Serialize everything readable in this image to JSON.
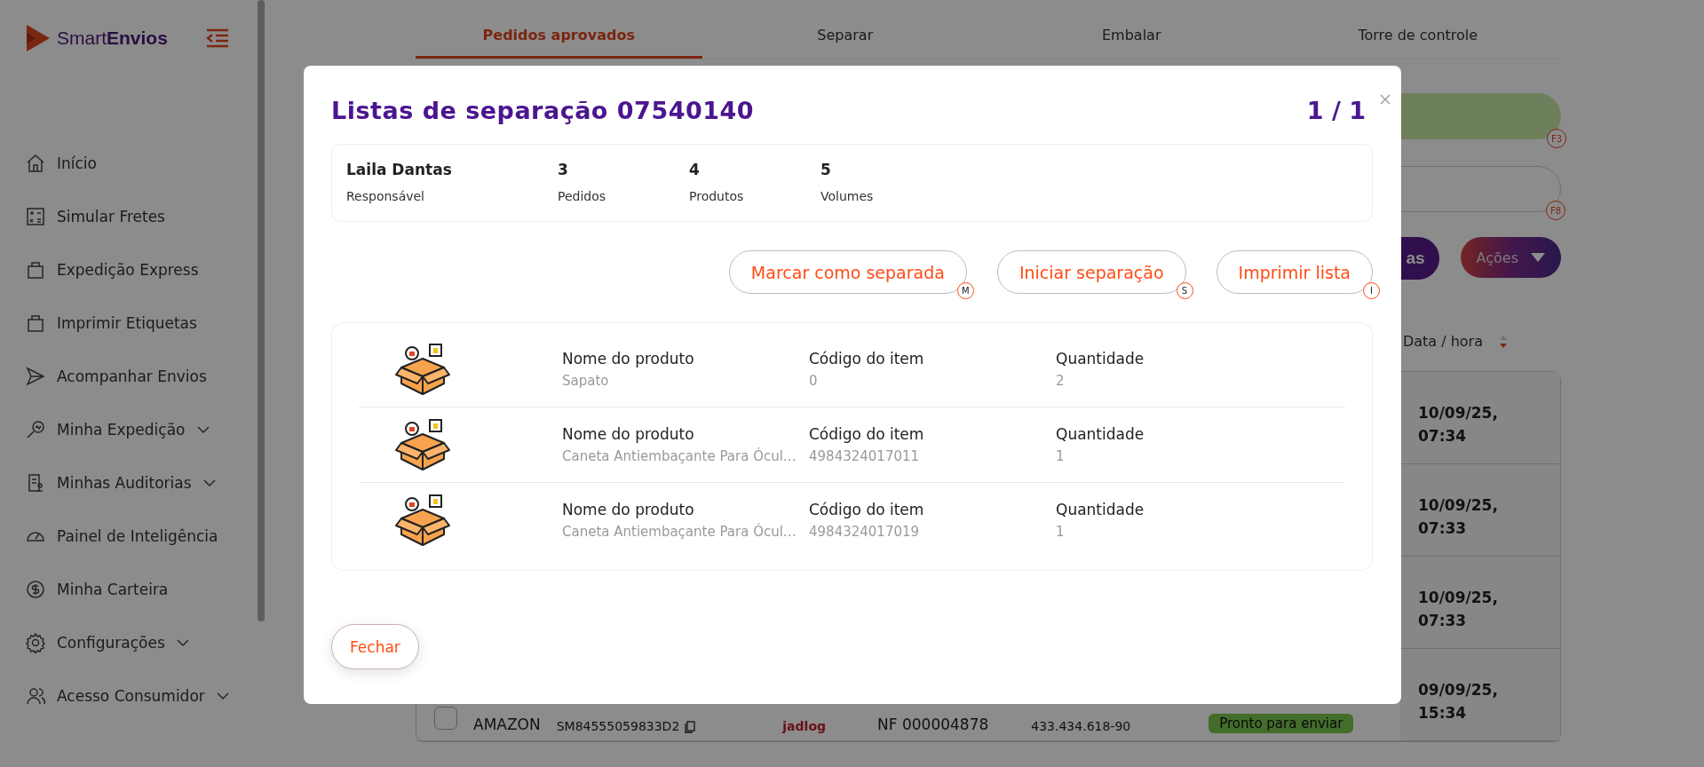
{
  "sidebar": {
    "logo": {
      "light": "Smart",
      "bold": "Envios"
    },
    "items": [
      {
        "label": "Início",
        "expandable": false
      },
      {
        "label": "Simular Fretes",
        "expandable": false
      },
      {
        "label": "Expedição Express",
        "expandable": false
      },
      {
        "label": "Imprimir Etiquetas",
        "expandable": false
      },
      {
        "label": "Acompanhar Envios",
        "expandable": false
      },
      {
        "label": "Minha Expedição",
        "expandable": true
      },
      {
        "label": "Minhas Auditorias",
        "expandable": true
      },
      {
        "label": "Painel de Inteligência",
        "expandable": false
      },
      {
        "label": "Minha Carteira",
        "expandable": false
      },
      {
        "label": "Configurações",
        "expandable": true
      },
      {
        "label": "Acesso Consumidor",
        "expandable": true
      }
    ]
  },
  "tabs": [
    {
      "label": "Pedidos aprovados",
      "selected": true
    },
    {
      "label": "Separar",
      "selected": false
    },
    {
      "label": "Embalar",
      "selected": false
    },
    {
      "label": "Torre de controle",
      "selected": false
    }
  ],
  "shortcuts": [
    "F3",
    "F8"
  ],
  "toolbar": {
    "partial_button": "as",
    "actions_button": "Ações"
  },
  "table": {
    "date_header": "Data / hora",
    "rows": [
      {
        "date": "10/09/25,",
        "time": "07:34"
      },
      {
        "date": "10/09/25,",
        "time": "07:33"
      },
      {
        "date": "10/09/25,",
        "time": "07:33"
      },
      {
        "date": "09/09/25,",
        "time": "15:34",
        "checked": false,
        "store": "AMAZON",
        "tracking": "SM84555059833D2",
        "carrier": "jadlog",
        "invoice": "NF 000004878",
        "document": "433.434.618-90",
        "status": "Pronto para enviar"
      }
    ]
  },
  "modal": {
    "title": "Listas de separação 07540140",
    "pager": "1 / 1",
    "summary": [
      {
        "value": "Laila Dantas",
        "label": "Responsável"
      },
      {
        "value": "3",
        "label": "Pedidos"
      },
      {
        "value": "4",
        "label": "Produtos"
      },
      {
        "value": "5",
        "label": "Volumes"
      }
    ],
    "actions": [
      {
        "label": "Marcar como separada",
        "key": "M"
      },
      {
        "label": "Iniciar separação",
        "key": "S"
      },
      {
        "label": "Imprimir lista",
        "key": "I"
      }
    ],
    "products": [
      {
        "name_label": "Nome do produto",
        "name": "Sapato",
        "code_label": "Código do item",
        "code": "0",
        "qty_label": "Quantidade",
        "qty": "2"
      },
      {
        "name_label": "Nome do produto",
        "name": "Caneta Antiembaçante Para Ócul…",
        "code_label": "Código do item",
        "code": "4984324017011",
        "qty_label": "Quantidade",
        "qty": "1"
      },
      {
        "name_label": "Nome do produto",
        "name": "Caneta Antiembaçante Para Ócul…",
        "code_label": "Código do item",
        "code": "4984324017019",
        "qty_label": "Quantidade",
        "qty": "1"
      }
    ],
    "close_button": "Fechar"
  }
}
